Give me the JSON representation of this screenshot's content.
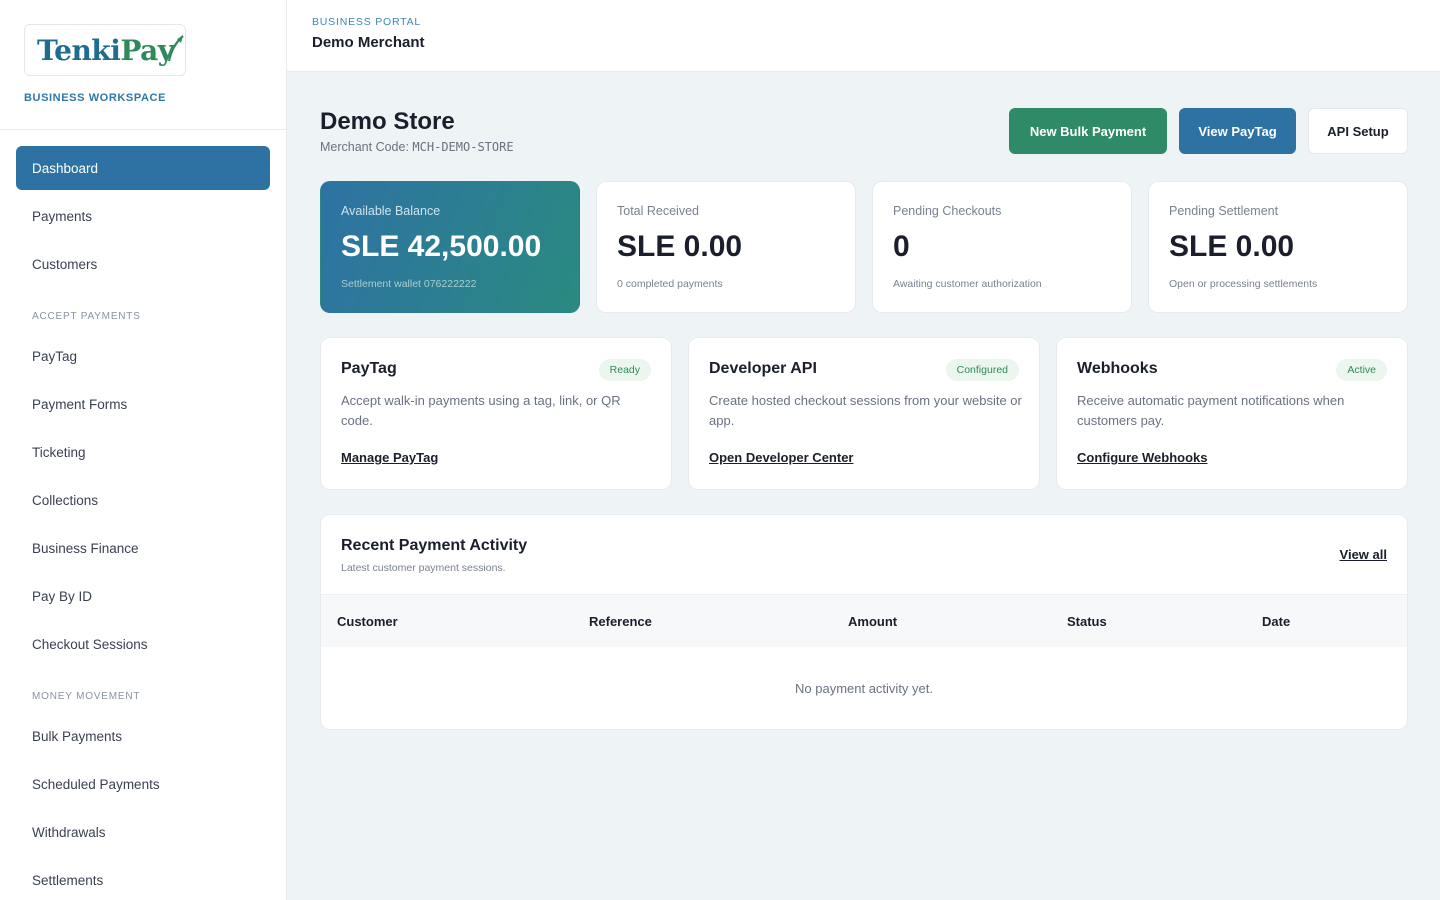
{
  "brand": {
    "logo_text_1": "Tenki",
    "logo_text_2": "Pay",
    "workspace_label": "BUSINESS WORKSPACE"
  },
  "sidebar": {
    "items": [
      {
        "label": "Dashboard",
        "active": true
      },
      {
        "label": "Payments"
      },
      {
        "label": "Customers"
      }
    ],
    "sections": [
      {
        "title": "ACCEPT PAYMENTS",
        "items": [
          "PayTag",
          "Payment Forms",
          "Ticketing",
          "Collections",
          "Business Finance",
          "Pay By ID",
          "Checkout Sessions"
        ]
      },
      {
        "title": "MONEY MOVEMENT",
        "items": [
          "Bulk Payments",
          "Scheduled Payments",
          "Withdrawals",
          "Settlements"
        ]
      }
    ]
  },
  "header": {
    "portal_label": "BUSINESS PORTAL",
    "merchant_name": "Demo Merchant"
  },
  "page": {
    "title": "Demo Store",
    "merchant_code_label": "Merchant Code:",
    "merchant_code": "MCH-DEMO-STORE",
    "actions": {
      "bulk_payment": "New Bulk Payment",
      "view_paytag": "View PayTag",
      "api_setup": "API Setup"
    }
  },
  "stats": [
    {
      "label": "Available Balance",
      "value": "SLE 42,500.00",
      "sub": "Settlement wallet 076222222"
    },
    {
      "label": "Total Received",
      "value": "SLE 0.00",
      "sub": "0 completed payments"
    },
    {
      "label": "Pending Checkouts",
      "value": "0",
      "sub": "Awaiting customer authorization"
    },
    {
      "label": "Pending Settlement",
      "value": "SLE 0.00",
      "sub": "Open or processing settlements"
    }
  ],
  "features": [
    {
      "title": "PayTag",
      "badge": "Ready",
      "desc": "Accept walk-in payments using a tag, link, or QR code.",
      "link": "Manage PayTag"
    },
    {
      "title": "Developer API",
      "badge": "Configured",
      "desc": "Create hosted checkout sessions from your website or app.",
      "link": "Open Developer Center"
    },
    {
      "title": "Webhooks",
      "badge": "Active",
      "desc": "Receive automatic payment notifications when customers pay.",
      "link": "Configure Webhooks"
    }
  ],
  "activity": {
    "title": "Recent Payment Activity",
    "subtitle": "Latest customer payment sessions.",
    "view_all": "View all",
    "columns": [
      "Customer",
      "Reference",
      "Amount",
      "Status",
      "Date"
    ],
    "empty_message": "No payment activity yet."
  },
  "colors": {
    "primary_blue": "#2e72a4",
    "accent_green": "#2f8b67",
    "badge_green_bg": "#eaf6ee",
    "badge_green_text": "#2f8b57"
  }
}
